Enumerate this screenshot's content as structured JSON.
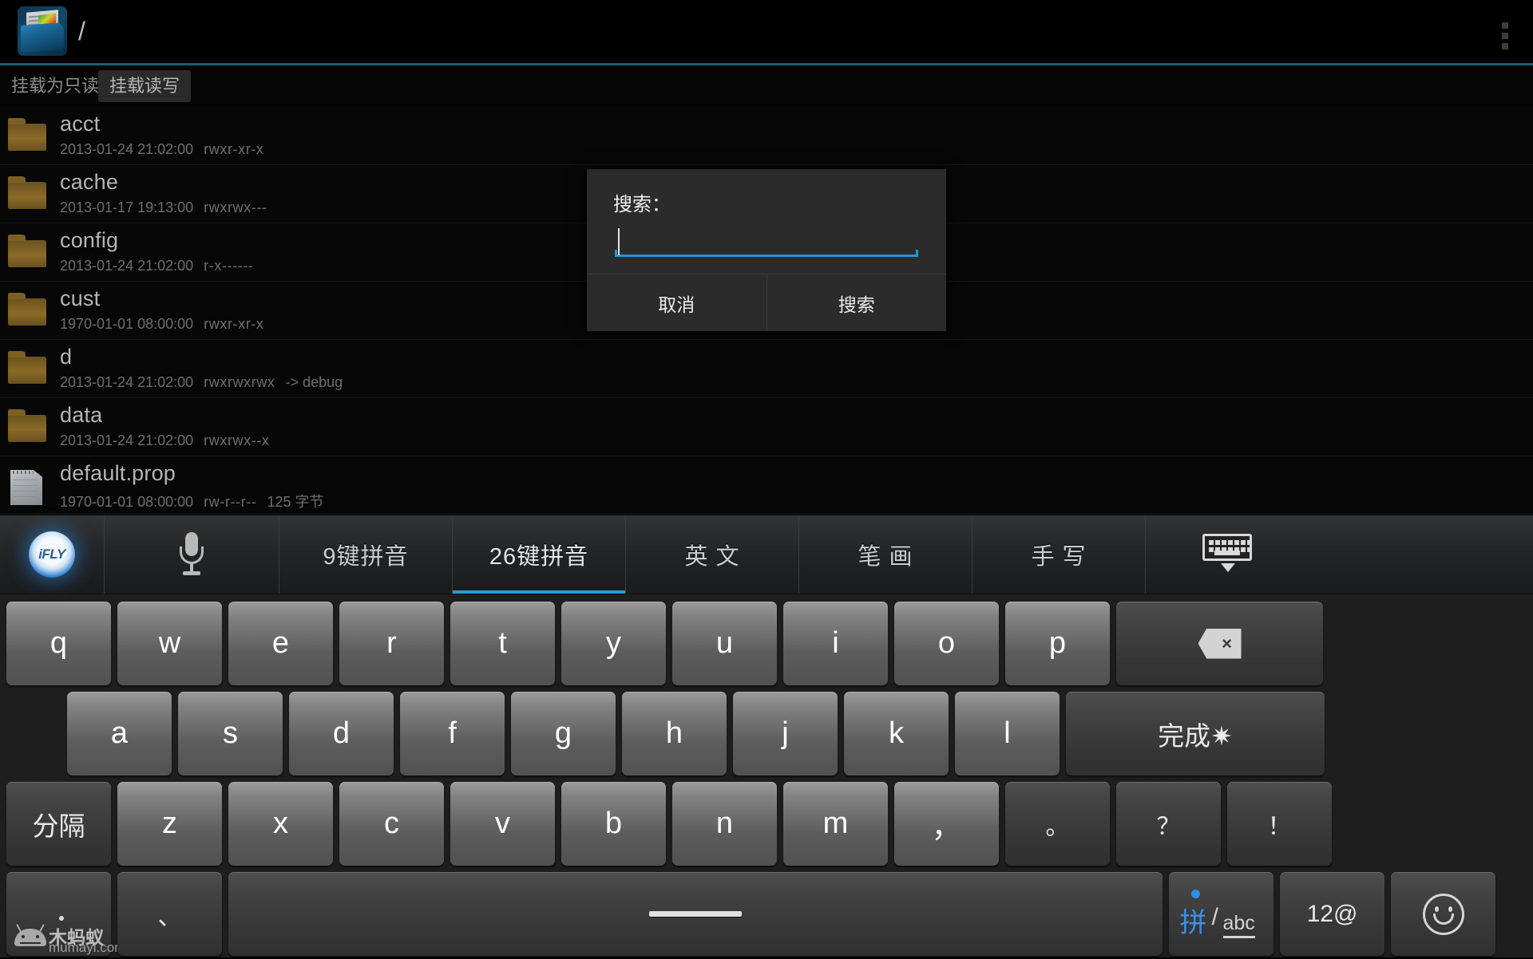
{
  "actionbar": {
    "app_icon": "file-manager-icon",
    "path": "/",
    "overflow": "overflow-menu-icon"
  },
  "mountbar": {
    "mount_readonly": "挂载为只读",
    "mount_readwrite": "挂载读写"
  },
  "filelist": {
    "rows": [
      {
        "name": "acct",
        "type": "folder",
        "date": "2013-01-24 21:02:00",
        "perm": "rwxr-xr-x",
        "extra": ""
      },
      {
        "name": "cache",
        "type": "folder",
        "date": "2013-01-17 19:13:00",
        "perm": "rwxrwx---",
        "extra": ""
      },
      {
        "name": "config",
        "type": "folder",
        "date": "2013-01-24 21:02:00",
        "perm": "r-x------",
        "extra": ""
      },
      {
        "name": "cust",
        "type": "folder",
        "date": "1970-01-01 08:00:00",
        "perm": "rwxr-xr-x",
        "extra": ""
      },
      {
        "name": "d",
        "type": "folder",
        "date": "2013-01-24 21:02:00",
        "perm": "rwxrwxrwx",
        "extra": "-> debug"
      },
      {
        "name": "data",
        "type": "folder",
        "date": "2013-01-24 21:02:00",
        "perm": "rwxrwx--x",
        "extra": ""
      },
      {
        "name": "default.prop",
        "type": "file",
        "date": "1970-01-01 08:00:00",
        "perm": "rw-r--r--",
        "extra": "125 字节"
      }
    ]
  },
  "dialog": {
    "title": "搜索：",
    "input_value": "",
    "input_placeholder": "",
    "cancel_label": "取消",
    "confirm_label": "搜索",
    "accent_color": "#2196d4"
  },
  "ime": {
    "toolbar": [
      {
        "key": "ifly",
        "label": "iFLY",
        "icon": "ifly-logo-icon",
        "active": false
      },
      {
        "key": "voice",
        "label": "",
        "icon": "microphone-icon",
        "active": false
      },
      {
        "key": "py9",
        "label": "9键拼音",
        "icon": "",
        "active": false
      },
      {
        "key": "py26",
        "label": "26键拼音",
        "icon": "",
        "active": true
      },
      {
        "key": "english",
        "label": "英 文",
        "icon": "",
        "active": false
      },
      {
        "key": "stroke",
        "label": "笔 画",
        "icon": "",
        "active": false
      },
      {
        "key": "handwrite",
        "label": "手 写",
        "icon": "",
        "active": false
      },
      {
        "key": "hide",
        "label": "",
        "icon": "hide-keyboard-icon",
        "active": false
      }
    ],
    "rows": [
      [
        {
          "label": "q",
          "type": "letter"
        },
        {
          "label": "w",
          "type": "letter"
        },
        {
          "label": "e",
          "type": "letter"
        },
        {
          "label": "r",
          "type": "letter"
        },
        {
          "label": "t",
          "type": "letter"
        },
        {
          "label": "y",
          "type": "letter"
        },
        {
          "label": "u",
          "type": "letter"
        },
        {
          "label": "i",
          "type": "letter"
        },
        {
          "label": "o",
          "type": "letter"
        },
        {
          "label": "p",
          "type": "letter"
        },
        {
          "label": "",
          "type": "backspace",
          "icon": "backspace-icon"
        }
      ],
      [
        {
          "label": "a",
          "type": "letter"
        },
        {
          "label": "s",
          "type": "letter"
        },
        {
          "label": "d",
          "type": "letter"
        },
        {
          "label": "f",
          "type": "letter"
        },
        {
          "label": "g",
          "type": "letter"
        },
        {
          "label": "h",
          "type": "letter"
        },
        {
          "label": "j",
          "type": "letter"
        },
        {
          "label": "k",
          "type": "letter"
        },
        {
          "label": "l",
          "type": "letter"
        },
        {
          "label": "完成✷",
          "type": "done"
        }
      ],
      [
        {
          "label": "分隔",
          "type": "separator"
        },
        {
          "label": "z",
          "type": "letter"
        },
        {
          "label": "x",
          "type": "letter"
        },
        {
          "label": "c",
          "type": "letter"
        },
        {
          "label": "v",
          "type": "letter"
        },
        {
          "label": "b",
          "type": "letter"
        },
        {
          "label": "n",
          "type": "letter"
        },
        {
          "label": "m",
          "type": "letter"
        },
        {
          "label": "，",
          "type": "letter"
        },
        {
          "label": "。",
          "type": "punct"
        },
        {
          "label": "？",
          "type": "punct"
        },
        {
          "label": "！",
          "type": "punct"
        }
      ],
      [
        {
          "label": "",
          "type": "blank"
        },
        {
          "label": "、",
          "type": "punct"
        },
        {
          "label": "",
          "type": "space",
          "icon": "spacebar-icon"
        },
        {
          "label": "拼/abc",
          "type": "pinyin-toggle",
          "icon": "pinyin-abc-toggle-icon"
        },
        {
          "label": "12@",
          "type": "symbols"
        },
        {
          "label": "",
          "type": "emoji",
          "icon": "smiley-icon"
        }
      ]
    ]
  },
  "watermark": {
    "cn": "木蚂蚁",
    "en": "mumayi.com",
    "icon": "android-robot-icon"
  }
}
